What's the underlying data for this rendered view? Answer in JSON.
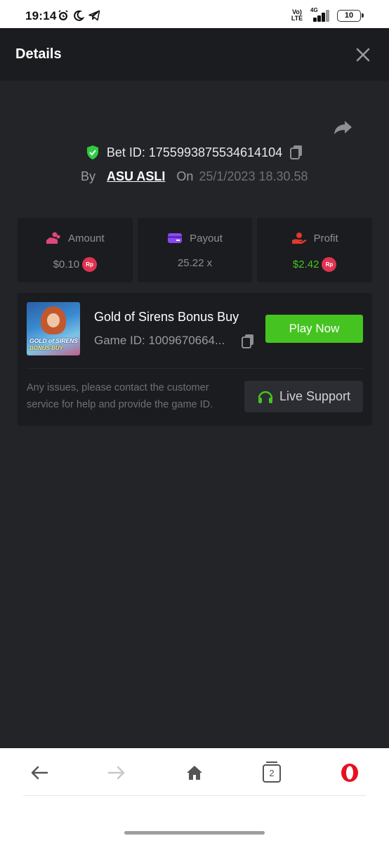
{
  "status_bar": {
    "time": "19:14",
    "volte_line1": "Vo)",
    "volte_line2": "LTE",
    "network": "4G",
    "battery": "10"
  },
  "header": {
    "title": "Details"
  },
  "bet": {
    "id_label": "Bet ID: 1755993875534614104",
    "by_label": "By",
    "user": "ASU ASLI",
    "on_label": "On",
    "date": "25/1/2023 18.30.58"
  },
  "stats": [
    {
      "label": "Amount",
      "value": "$0.10",
      "currency": "Rp",
      "value_color": "#8e8f95",
      "icon": "coins-hand-icon"
    },
    {
      "label": "Payout",
      "value": "25.22 x",
      "currency": "",
      "value_color": "#8e8f95",
      "icon": "card-icon"
    },
    {
      "label": "Profit",
      "value": "$2.42",
      "currency": "Rp",
      "value_color": "#45c421",
      "icon": "profit-hand-icon"
    }
  ],
  "game": {
    "thumbnail_line1": "GOLD of SIRENS",
    "thumbnail_line2": "BONUS BUY",
    "title": "Gold of Sirens Bonus Buy",
    "id_label": "Game ID: 1009670664...",
    "play_button": "Play Now",
    "help_text": "Any issues, please contact the customer service for help and provide the game ID.",
    "support_button": "Live Support"
  },
  "browser": {
    "tab_count": "2"
  },
  "colors": {
    "accent_green": "#45c421",
    "shield_green": "#2ecc40",
    "rp_red": "#e0334f",
    "amount_pink": "#e0487a",
    "payout_purple": "#8a4af3",
    "profit_red": "#e0392e",
    "opera_red": "#e8101f"
  }
}
